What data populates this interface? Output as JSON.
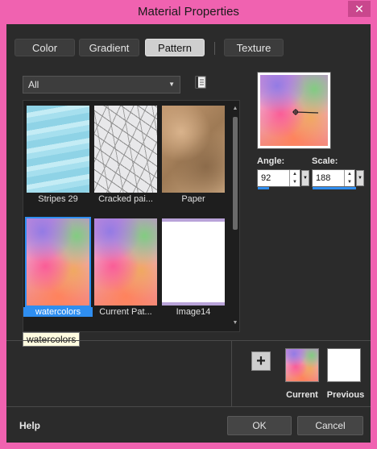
{
  "window": {
    "title": "Material Properties",
    "close_glyph": "✕"
  },
  "tabs": [
    {
      "label": "Color",
      "active": false
    },
    {
      "label": "Gradient",
      "active": false
    },
    {
      "label": "Pattern",
      "active": true
    },
    {
      "label": "Texture",
      "active": false
    }
  ],
  "filter": {
    "value": "All"
  },
  "gallery": {
    "items": [
      {
        "label": "Stripes 29",
        "selected": false
      },
      {
        "label": "Cracked pai...",
        "selected": false
      },
      {
        "label": "Paper",
        "selected": false
      },
      {
        "label": "watercolors",
        "selected": true
      },
      {
        "label": "Current Pat...",
        "selected": false
      },
      {
        "label": "Image14",
        "selected": false
      }
    ],
    "tooltip": "watercolors"
  },
  "angle": {
    "label": "Angle:",
    "value": "92"
  },
  "scale": {
    "label": "Scale:",
    "value": "188"
  },
  "swatches": {
    "current_label": "Current",
    "previous_label": "Previous"
  },
  "footer": {
    "help": "Help",
    "ok": "OK",
    "cancel": "Cancel"
  },
  "colors": {
    "accent": "#2f8ef0",
    "frame": "#f062b0",
    "dialog_bg": "#2b2b2b"
  }
}
